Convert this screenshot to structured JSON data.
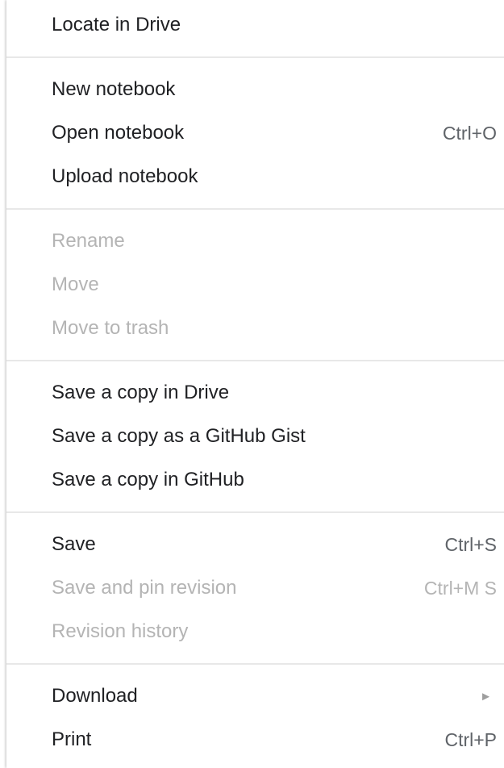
{
  "menu": {
    "groups": [
      {
        "items": [
          {
            "label": "Locate in Drive",
            "shortcut": "",
            "disabled": false,
            "submenu": false
          }
        ]
      },
      {
        "items": [
          {
            "label": "New notebook",
            "shortcut": "",
            "disabled": false,
            "submenu": false
          },
          {
            "label": "Open notebook",
            "shortcut": "Ctrl+O",
            "disabled": false,
            "submenu": false
          },
          {
            "label": "Upload notebook",
            "shortcut": "",
            "disabled": false,
            "submenu": false
          }
        ]
      },
      {
        "items": [
          {
            "label": "Rename",
            "shortcut": "",
            "disabled": true,
            "submenu": false
          },
          {
            "label": "Move",
            "shortcut": "",
            "disabled": true,
            "submenu": false
          },
          {
            "label": "Move to trash",
            "shortcut": "",
            "disabled": true,
            "submenu": false
          }
        ]
      },
      {
        "items": [
          {
            "label": "Save a copy in Drive",
            "shortcut": "",
            "disabled": false,
            "submenu": false
          },
          {
            "label": "Save a copy as a GitHub Gist",
            "shortcut": "",
            "disabled": false,
            "submenu": false
          },
          {
            "label": "Save a copy in GitHub",
            "shortcut": "",
            "disabled": false,
            "submenu": false
          }
        ]
      },
      {
        "items": [
          {
            "label": "Save",
            "shortcut": "Ctrl+S",
            "disabled": false,
            "submenu": false
          },
          {
            "label": "Save and pin revision",
            "shortcut": "Ctrl+M S",
            "disabled": true,
            "submenu": false
          },
          {
            "label": "Revision history",
            "shortcut": "",
            "disabled": true,
            "submenu": false
          }
        ]
      },
      {
        "items": [
          {
            "label": "Download",
            "shortcut": "",
            "disabled": false,
            "submenu": true
          },
          {
            "label": "Print",
            "shortcut": "Ctrl+P",
            "disabled": false,
            "submenu": false
          }
        ]
      }
    ],
    "submenu_glyph": "►"
  },
  "colors": {
    "text": "#202124",
    "disabled_text": "#b4b4b4",
    "shortcut_text": "#5f6368",
    "separator": "#e8e8e8",
    "background": "#ffffff"
  },
  "icons": {
    "submenu": "triangle-right-icon"
  }
}
